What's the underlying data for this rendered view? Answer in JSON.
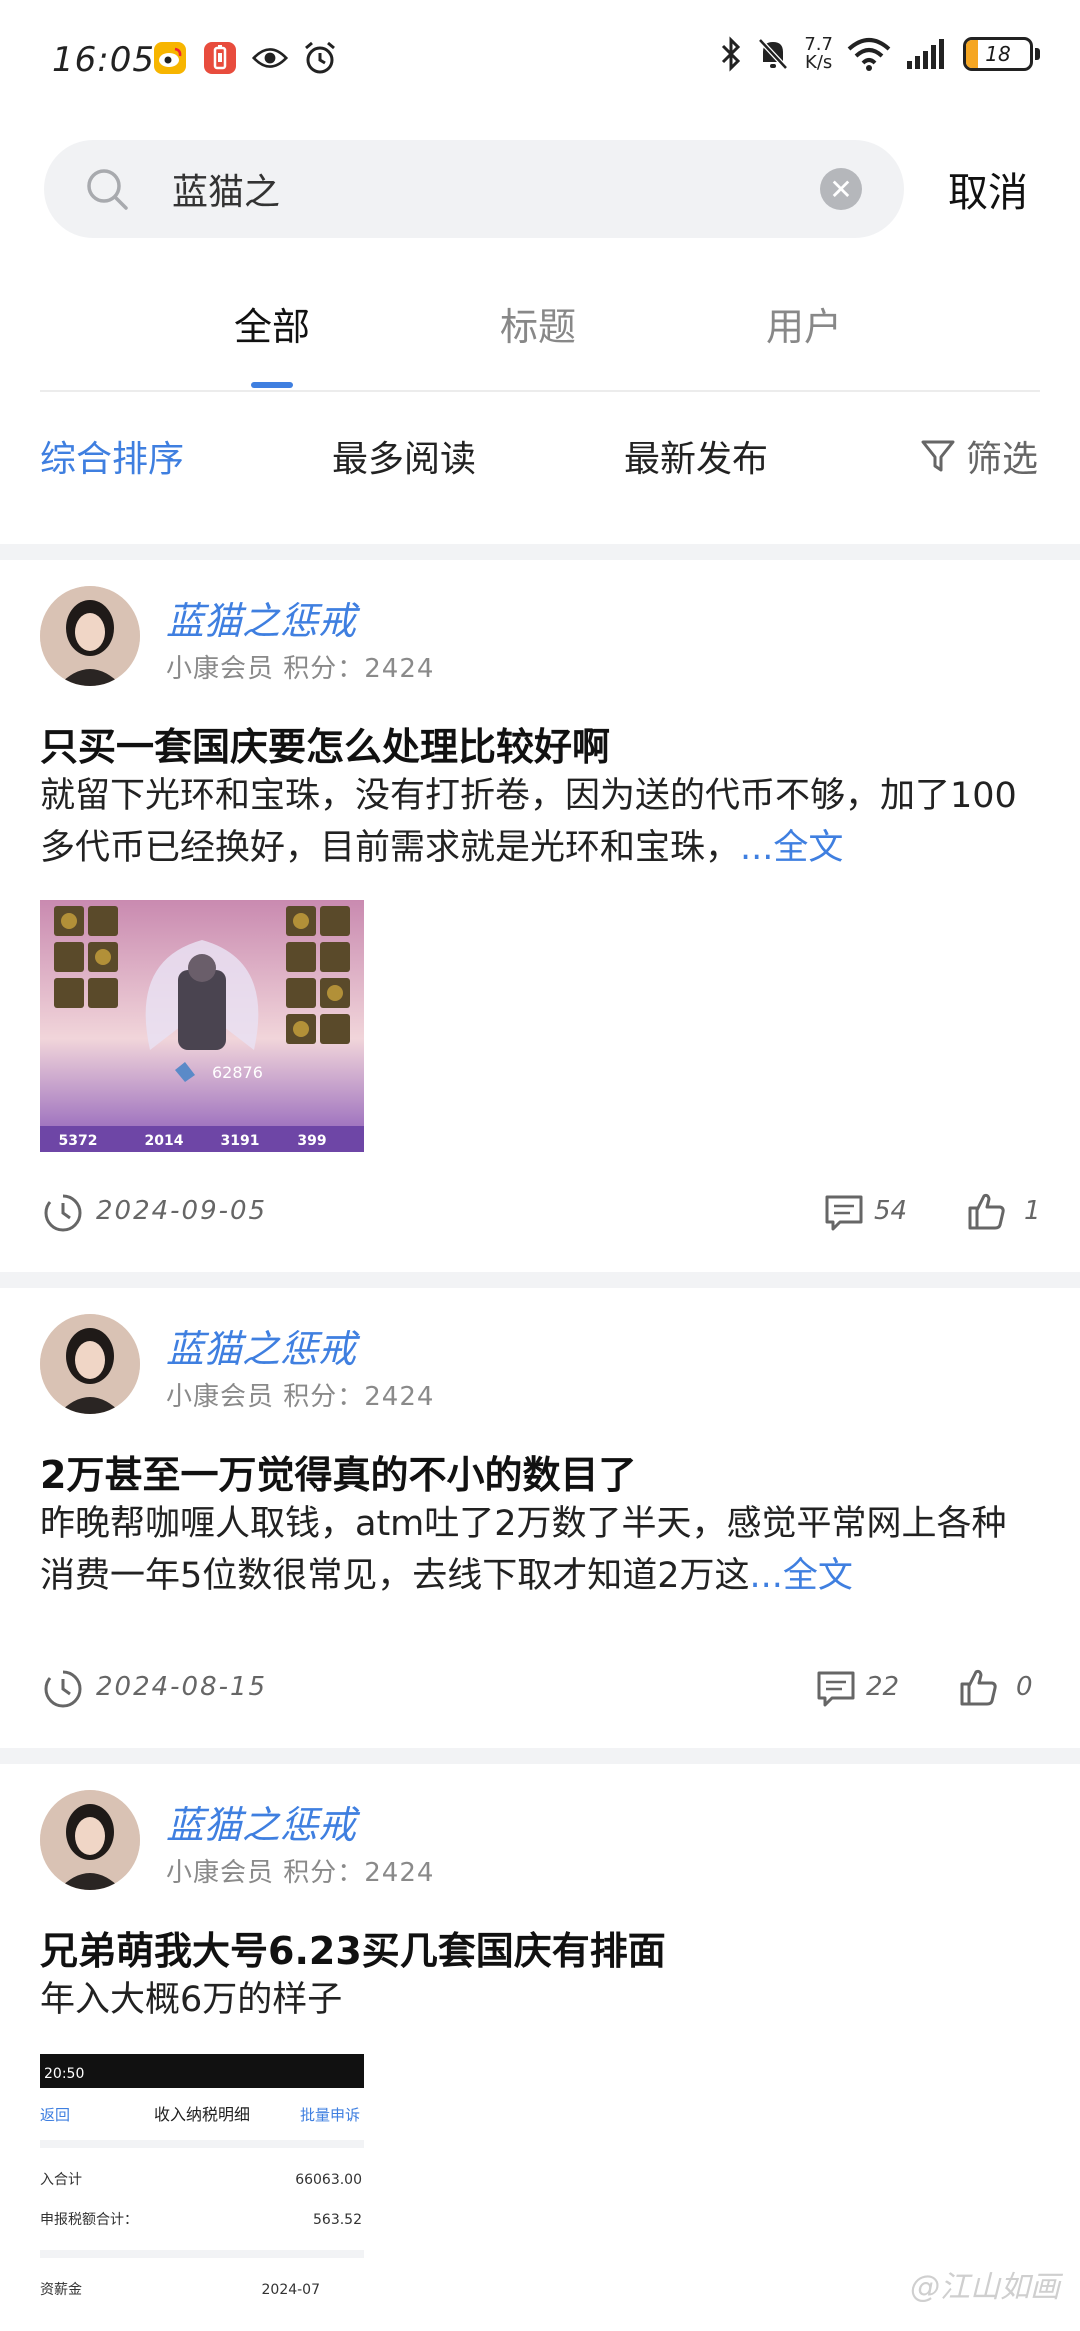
{
  "status_bar": {
    "time": "16:05",
    "net_speed": "7.7",
    "net_unit": "K/s",
    "battery": "18",
    "battery_level": 0.18,
    "left_icons": [
      "weibo-icon",
      "battery-saver-icon",
      "eye-icon",
      "alarm-icon"
    ],
    "right_icons": [
      "bluetooth-icon",
      "mute-icon",
      "wifi-icon",
      "signal-icon"
    ]
  },
  "search": {
    "value": "蓝猫之",
    "cancel_label": "取消"
  },
  "tabs": [
    {
      "label": "全部",
      "active": true
    },
    {
      "label": "标题",
      "active": false
    },
    {
      "label": "用户",
      "active": false
    }
  ],
  "sort": {
    "options": [
      "综合排序",
      "最多阅读",
      "最新发布"
    ],
    "active_index": 0,
    "filter_label": "筛选"
  },
  "colors": {
    "accent": "#3f7fe0",
    "band": "#f2f3f5"
  },
  "posts": [
    {
      "username": "蓝猫之惩戒",
      "userinfo": "小康会员  积分：2424",
      "title": "只买一套国庆要怎么处理比较好啊",
      "body": "就留下光环和宝珠，没有打折卷，因为送的代币不够，加了100多代币已经换好，目前需求就是光环和宝珠，",
      "more": "...全文",
      "image_stats": [
        "5372",
        "2014",
        "3191",
        "399"
      ],
      "image_score": "62876",
      "date": "2024-09-05",
      "comments": "54",
      "likes": "1"
    },
    {
      "username": "蓝猫之惩戒",
      "userinfo": "小康会员  积分：2424",
      "title": "2万甚至一万觉得真的不小的数目了",
      "body": "昨晚帮咖喱人取钱，atm吐了2万数了半天，感觉平常网上各种消费一年5位数很常见，去线下取才知道2万这",
      "more": "...全文",
      "date": "2024-08-15",
      "comments": "22",
      "likes": "0"
    },
    {
      "username": "蓝猫之惩戒",
      "userinfo": "小康会员  积分：2424",
      "title": "兄弟萌我大号6.23买几套国庆有排面",
      "body": "年入大概6万的样子",
      "image": {
        "time": "20:50",
        "back": "返回",
        "title": "收入纳税明细",
        "action": "批量申诉",
        "rows": [
          {
            "label": "入合计",
            "value": "66063.00"
          },
          {
            "label": "申报税额合计：",
            "value": "563.52"
          },
          {
            "label": "资薪金",
            "value": "2024-07"
          }
        ]
      }
    }
  ],
  "watermark": "@江山如画"
}
